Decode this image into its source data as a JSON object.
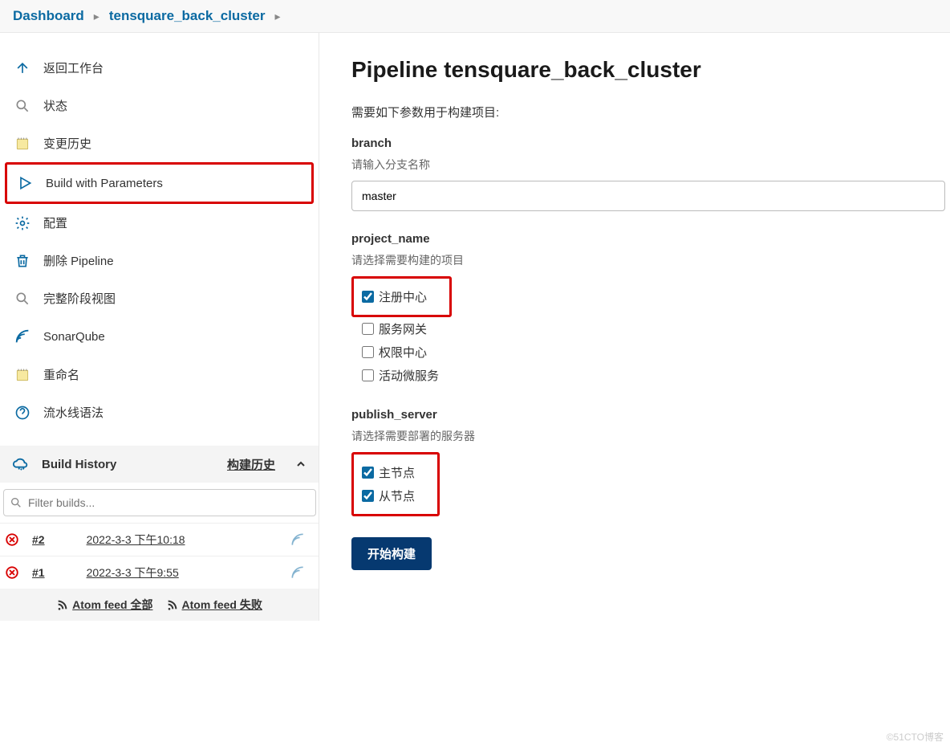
{
  "breadcrumb": {
    "dashboard": "Dashboard",
    "project": "tensquare_back_cluster"
  },
  "sidebar": {
    "items": [
      {
        "label": "返回工作台"
      },
      {
        "label": "状态"
      },
      {
        "label": "变更历史"
      },
      {
        "label": "Build with Parameters"
      },
      {
        "label": "配置"
      },
      {
        "label": "删除 Pipeline"
      },
      {
        "label": "完整阶段视图"
      },
      {
        "label": "SonarQube"
      },
      {
        "label": "重命名"
      },
      {
        "label": "流水线语法"
      }
    ]
  },
  "history": {
    "title": "Build History",
    "subtitle": "构建历史",
    "filter_placeholder": "Filter builds...",
    "builds": [
      {
        "num": "#2",
        "date": "2022-3-3 下午10:18"
      },
      {
        "num": "#1",
        "date": "2022-3-3 下午9:55"
      }
    ],
    "feed_all": "Atom feed 全部",
    "feed_fail": "Atom feed 失败"
  },
  "main": {
    "title": "Pipeline tensquare_back_cluster",
    "hint": "需要如下参数用于构建项目:",
    "branch": {
      "label": "branch",
      "desc": "请输入分支名称",
      "value": "master"
    },
    "project": {
      "label": "project_name",
      "desc": "请选择需要构建的项目",
      "options": [
        {
          "label": "注册中心",
          "checked": true
        },
        {
          "label": "服务网关",
          "checked": false
        },
        {
          "label": "权限中心",
          "checked": false
        },
        {
          "label": "活动微服务",
          "checked": false
        }
      ]
    },
    "publish": {
      "label": "publish_server",
      "desc": "请选择需要部署的服务器",
      "options": [
        {
          "label": "主节点",
          "checked": true
        },
        {
          "label": "从节点",
          "checked": true
        }
      ]
    },
    "build_btn": "开始构建"
  },
  "watermark": "©51CTO博客"
}
